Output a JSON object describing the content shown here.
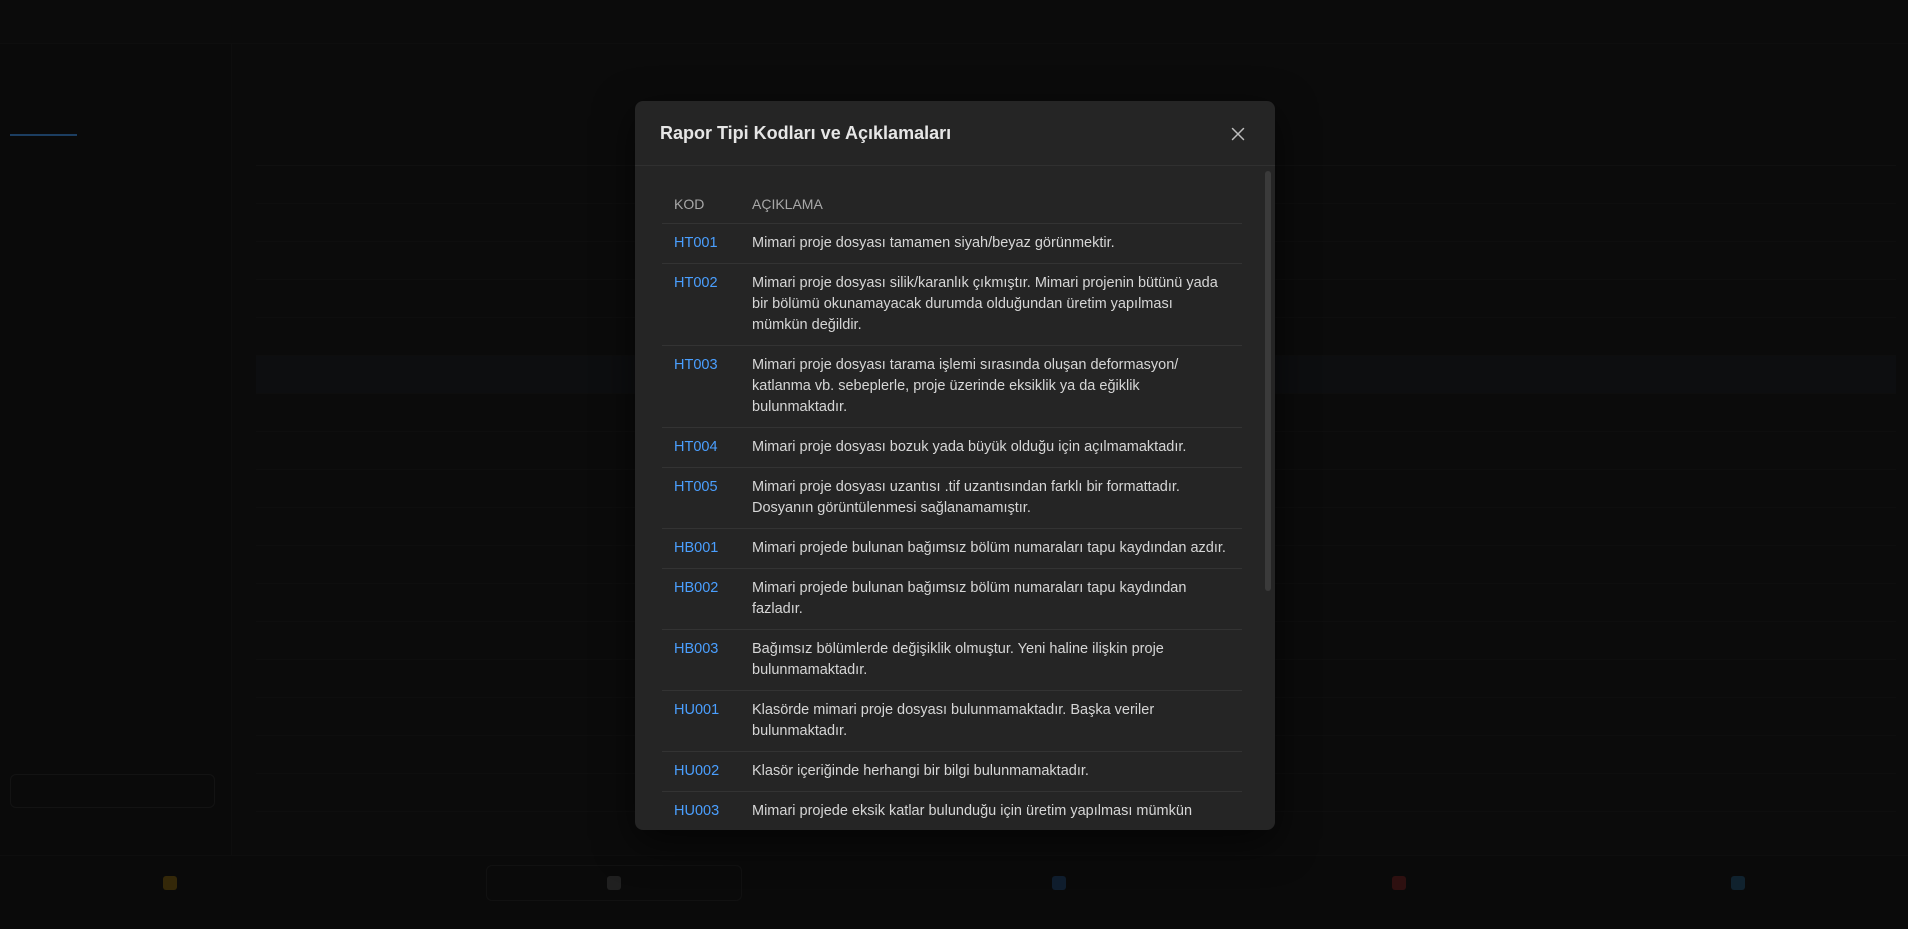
{
  "modal": {
    "title": "Rapor Tipi Kodları ve Açıklamaları",
    "columns": {
      "code": "KOD",
      "description": "AÇIKLAMA"
    },
    "rows": [
      {
        "code": "HT001",
        "description": "Mimari proje dosyası tamamen siyah/beyaz görünmektir."
      },
      {
        "code": "HT002",
        "description": "Mimari proje dosyası silik/karanlık çıkmıştır. Mimari projenin bütünü yada bir bölümü okunamayacak durumda olduğundan üretim yapılması mümkün değildir."
      },
      {
        "code": "HT003",
        "description": "Mimari proje dosyası tarama işlemi sırasında oluşan deformasyon/ katlanma vb. sebeplerle, proje üzerinde eksiklik ya da eğiklik bulunmaktadır."
      },
      {
        "code": "HT004",
        "description": "Mimari proje dosyası bozuk yada büyük olduğu için açılmamaktadır."
      },
      {
        "code": "HT005",
        "description": "Mimari proje dosyası uzantısı .tif uzantısından farklı bir formattadır. Dosyanın görüntülenmesi sağlanamamıştır."
      },
      {
        "code": "HB001",
        "description": "Mimari projede bulunan bağımsız bölüm numaraları tapu kaydından azdır."
      },
      {
        "code": "HB002",
        "description": "Mimari projede bulunan bağımsız bölüm numaraları tapu kaydından fazladır."
      },
      {
        "code": "HB003",
        "description": "Bağımsız bölümlerde değişiklik olmuştur. Yeni haline ilişkin proje bulunmamaktadır."
      },
      {
        "code": "HU001",
        "description": "Klasörde mimari proje dosyası bulunmamaktadır. Başka veriler bulunmaktadır."
      },
      {
        "code": "HU002",
        "description": "Klasör içeriğinde herhangi bir bilgi bulunmamaktadır."
      },
      {
        "code": "HU003",
        "description": "Mimari projede eksik katlar bulunduğu için üretim yapılması mümkün"
      }
    ]
  },
  "colors": {
    "accent": "#4a9fff",
    "modal_bg": "#252525",
    "backdrop": "#101010"
  },
  "icons": {
    "close": "close-icon"
  }
}
